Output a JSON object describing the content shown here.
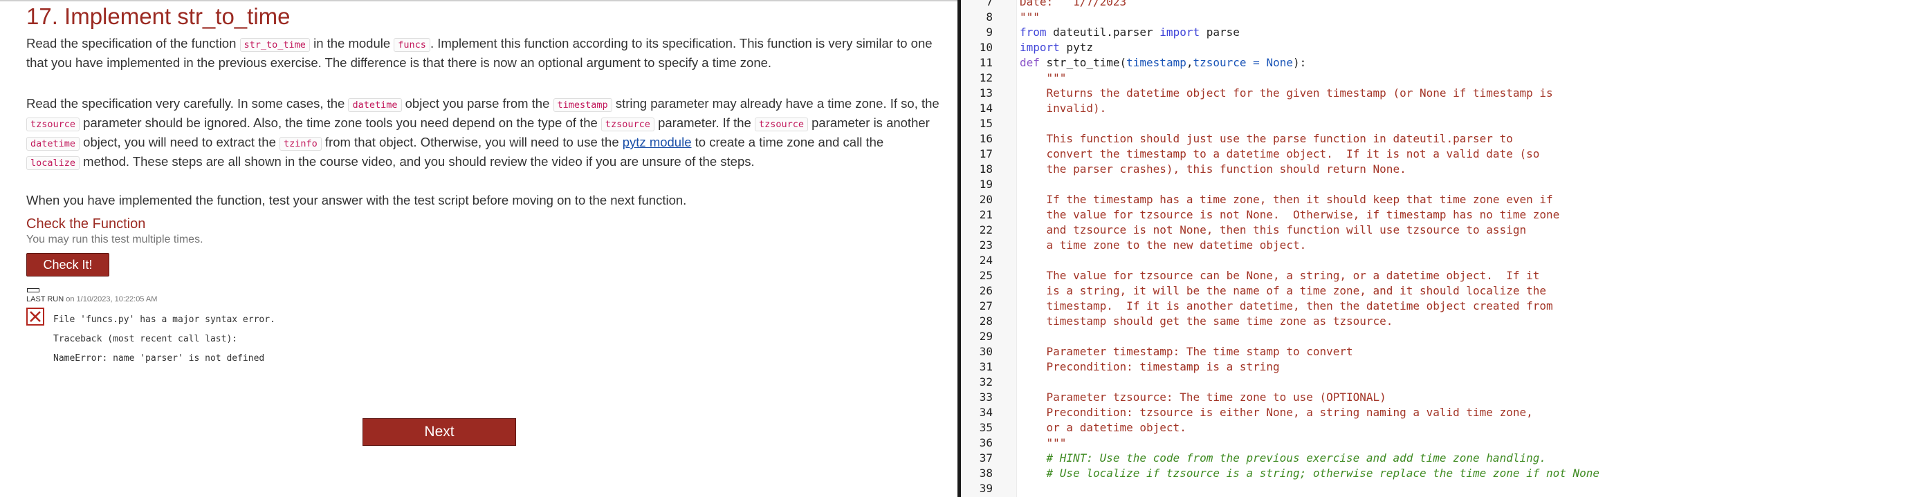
{
  "instructions": {
    "title": "17. Implement str_to_time",
    "para1": {
      "t1": "Read the specification of the function ",
      "c1": "str_to_time",
      "t2": " in the module ",
      "c2": "funcs",
      "t3": ". Implement this function according to its specification. This function is very similar to one that you have implemented in the previous exercise. The difference is that there is now an optional argument to specify a time zone."
    },
    "para2": {
      "t1": "Read the specification very carefully. In some cases, the ",
      "c1": "datetime",
      "t2": " object you parse from the ",
      "c2": "timestamp",
      "t3": " string parameter may already have a time zone. If so, the ",
      "c3": "tzsource",
      "t4": " parameter should be ignored. Also, the time zone tools you need depend on the type of the ",
      "c4": "tzsource",
      "t5": " parameter. If the ",
      "c5": "tzsource",
      "t6": " parameter is another ",
      "c6": "datetime",
      "t7": " object, you will need to extract the ",
      "c7": "tzinfo",
      "t8": " from that object. Otherwise, you will need to use the ",
      "link": "pytz module",
      "t9": " to create a time zone and call the ",
      "c8": "localize",
      "t10": " method. These steps are all shown in the course video, and you should review the video if you are unsure of the steps."
    },
    "para3": "When you have implemented the function, test your answer with the test script before moving on to the next function."
  },
  "check": {
    "heading": "Check the Function",
    "subtitle": "You may run this test multiple times.",
    "button_label": "Check It!",
    "last_run_label": "LAST RUN",
    "last_run_time": "on 1/10/2023, 10:22:05 AM",
    "status_icon": "error-x-icon",
    "output_lines": [
      "File 'funcs.py' has a major syntax error.",
      "Traceback (most recent call last):",
      "NameError: name 'parser' is not defined"
    ]
  },
  "next_button": "Next",
  "editor": {
    "lines": [
      {
        "n": "7",
        "parts": [
          {
            "t": "Date:   1/7/2023",
            "c": "ds"
          }
        ]
      },
      {
        "n": "8",
        "parts": [
          {
            "t": "\"\"\"",
            "c": "ds"
          }
        ]
      },
      {
        "n": "9",
        "parts": [
          {
            "t": "from",
            "c": "kw"
          },
          {
            "t": " dateutil.parser ",
            "c": ""
          },
          {
            "t": "import",
            "c": "kw"
          },
          {
            "t": " parse",
            "c": ""
          }
        ]
      },
      {
        "n": "10",
        "parts": [
          {
            "t": "import",
            "c": "kw"
          },
          {
            "t": " pytz",
            "c": ""
          }
        ]
      },
      {
        "n": "11",
        "parts": [
          {
            "t": "def",
            "c": "def"
          },
          {
            "t": " str_to_time(",
            "c": ""
          },
          {
            "t": "timestamp",
            "c": "param"
          },
          {
            "t": ",",
            "c": ""
          },
          {
            "t": "tzsource = None",
            "c": "param"
          },
          {
            "t": "):",
            "c": ""
          }
        ]
      },
      {
        "n": "12",
        "parts": [
          {
            "t": "    \"\"\"",
            "c": "ds"
          }
        ]
      },
      {
        "n": "13",
        "parts": [
          {
            "t": "    Returns the datetime object for the given timestamp (or None if timestamp is",
            "c": "ds"
          }
        ]
      },
      {
        "n": "14",
        "parts": [
          {
            "t": "    invalid).",
            "c": "ds"
          }
        ]
      },
      {
        "n": "15",
        "parts": []
      },
      {
        "n": "16",
        "parts": [
          {
            "t": "    This function should just use the parse function in dateutil.parser to",
            "c": "ds"
          }
        ]
      },
      {
        "n": "17",
        "parts": [
          {
            "t": "    convert the timestamp to a datetime object.  If it is not a valid date (so",
            "c": "ds"
          }
        ]
      },
      {
        "n": "18",
        "parts": [
          {
            "t": "    the parser crashes), this function should return None.",
            "c": "ds"
          }
        ]
      },
      {
        "n": "19",
        "parts": []
      },
      {
        "n": "20",
        "parts": [
          {
            "t": "    If the timestamp has a time zone, then it should keep that time zone even if",
            "c": "ds"
          }
        ]
      },
      {
        "n": "21",
        "parts": [
          {
            "t": "    the value for tzsource is not None.  Otherwise, if timestamp has no time zone",
            "c": "ds"
          }
        ]
      },
      {
        "n": "22",
        "parts": [
          {
            "t": "    and tzsource is not None, then this function will use tzsource to assign",
            "c": "ds"
          }
        ]
      },
      {
        "n": "23",
        "parts": [
          {
            "t": "    a time zone to the new datetime object.",
            "c": "ds"
          }
        ]
      },
      {
        "n": "24",
        "parts": []
      },
      {
        "n": "25",
        "parts": [
          {
            "t": "    The value for tzsource can be None, a string, or a datetime object.  If it",
            "c": "ds"
          }
        ]
      },
      {
        "n": "26",
        "parts": [
          {
            "t": "    is a string, it will be the name of a time zone, and it should localize the",
            "c": "ds"
          }
        ]
      },
      {
        "n": "27",
        "parts": [
          {
            "t": "    timestamp.  If it is another datetime, then the datetime object created from",
            "c": "ds"
          }
        ]
      },
      {
        "n": "28",
        "parts": [
          {
            "t": "    timestamp should get the same time zone as tzsource.",
            "c": "ds"
          }
        ]
      },
      {
        "n": "29",
        "parts": []
      },
      {
        "n": "30",
        "parts": [
          {
            "t": "    Parameter timestamp: The time stamp to convert",
            "c": "ds"
          }
        ]
      },
      {
        "n": "31",
        "parts": [
          {
            "t": "    Precondition: timestamp is a string",
            "c": "ds"
          }
        ]
      },
      {
        "n": "32",
        "parts": []
      },
      {
        "n": "33",
        "parts": [
          {
            "t": "    Parameter tzsource: The time zone to use (OPTIONAL)",
            "c": "ds"
          }
        ]
      },
      {
        "n": "34",
        "parts": [
          {
            "t": "    Precondition: tzsource is either None, a string naming a valid time zone,",
            "c": "ds"
          }
        ]
      },
      {
        "n": "35",
        "parts": [
          {
            "t": "    or a datetime object.",
            "c": "ds"
          }
        ]
      },
      {
        "n": "36",
        "parts": [
          {
            "t": "    \"\"\"",
            "c": "ds"
          }
        ]
      },
      {
        "n": "37",
        "parts": [
          {
            "t": "    # HINT: Use the code from the previous exercise and add time zone handling.",
            "c": "cm"
          }
        ]
      },
      {
        "n": "38",
        "parts": [
          {
            "t": "    # Use localize if tzsource is a string; otherwise replace the time zone if not None",
            "c": "cm"
          }
        ]
      },
      {
        "n": "39",
        "parts": []
      }
    ]
  }
}
